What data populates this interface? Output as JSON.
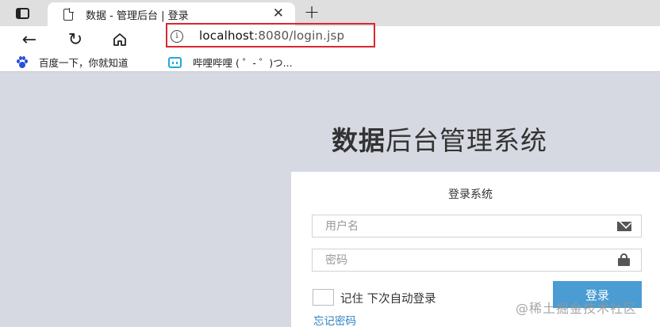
{
  "browser": {
    "tab": {
      "title": "数据 - 管理后台 | 登录",
      "close": "✕"
    },
    "new_tab": "+",
    "nav": {
      "back": "←",
      "refresh": "↻"
    },
    "address": {
      "info": "i",
      "host": "localhost",
      "rest": ":8080/login.jsp"
    },
    "bookmarks": [
      {
        "label": "百度一下，你就知道",
        "icon": "baidu-paw-icon"
      },
      {
        "label": "哔哩哔哩 ( ゜- ゜)つ...",
        "icon": "bilibili-tv-icon"
      }
    ]
  },
  "page": {
    "title_bold": "数据",
    "title_rest": "后台管理系统",
    "login": {
      "heading": "登录系统",
      "username_placeholder": "用户名",
      "password_placeholder": "密码",
      "remember_label": "记住 下次自动登录",
      "login_button": "登录",
      "forgot_link": "忘记密码"
    }
  },
  "watermark": "@稀土掘金技术社区",
  "colors": {
    "page_background": "#d6d9e2",
    "login_button": "#4a9cd3",
    "link": "#2c7fbf",
    "address_highlight": "#d9272e"
  }
}
